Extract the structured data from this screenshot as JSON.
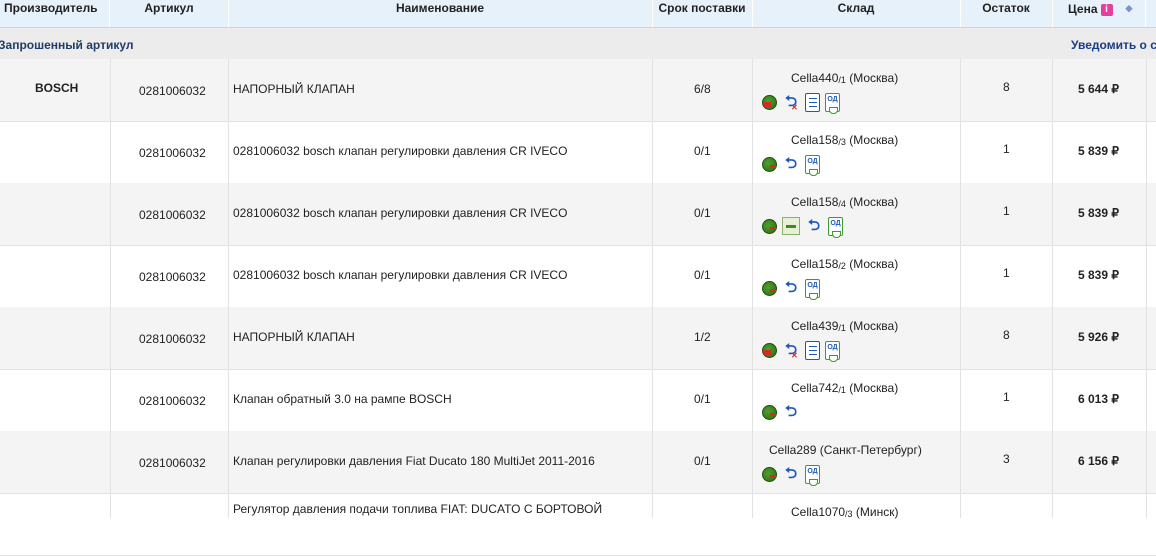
{
  "columns": {
    "manufacturer": "Производитель",
    "article": "Артикул",
    "name": "Наименование",
    "delivery": "Срок поставки",
    "warehouse": "Склад",
    "stock": "Остаток",
    "price": "Цена",
    "price_info_icon": "i"
  },
  "group": {
    "label": "Запрошенный артикул",
    "notify": "Уведомить о с"
  },
  "currency": "₽",
  "rows": [
    {
      "brand": "BOSCH",
      "article": "0281006032",
      "name": "НАПОРНЫЙ КЛАПАН",
      "delivery": "6/8",
      "warehouse": "Cella440",
      "wh_sub": "/1",
      "city": "(Москва)",
      "stock": "8",
      "price": "5 644",
      "icons": [
        "stock-partial-icon",
        "return-blocked-icon",
        "document-icon",
        "od-document-icon"
      ]
    },
    {
      "brand": "",
      "article": "0281006032",
      "name": "0281006032 bosch клапан регулировки давления CR IVECO",
      "delivery": "0/1",
      "warehouse": "Cella158",
      "wh_sub": "/3",
      "city": "(Москва)",
      "stock": "1",
      "price": "5 839",
      "icons": [
        "stock-icon",
        "return-icon",
        "od-document-icon"
      ]
    },
    {
      "brand": "",
      "article": "0281006032",
      "name": "0281006032 bosch клапан регулировки давления CR IVECO",
      "delivery": "0/1",
      "warehouse": "Cella158",
      "wh_sub": "/4",
      "city": "(Москва)",
      "stock": "1",
      "price": "5 839",
      "icons": [
        "stock-icon",
        "truck-icon",
        "return-icon",
        "od-document-icon"
      ]
    },
    {
      "brand": "",
      "article": "0281006032",
      "name": "0281006032 bosch клапан регулировки давления CR IVECO",
      "delivery": "0/1",
      "warehouse": "Cella158",
      "wh_sub": "/2",
      "city": "(Москва)",
      "stock": "1",
      "price": "5 839",
      "icons": [
        "stock-icon",
        "return-icon",
        "od-document-icon"
      ]
    },
    {
      "brand": "",
      "article": "0281006032",
      "name": "НАПОРНЫЙ КЛАПАН",
      "delivery": "1/2",
      "warehouse": "Cella439",
      "wh_sub": "/1",
      "city": "(Москва)",
      "stock": "8",
      "price": "5 926",
      "icons": [
        "stock-partial-icon",
        "return-blocked-icon",
        "document-icon",
        "od-document-icon"
      ]
    },
    {
      "brand": "",
      "article": "0281006032",
      "name": "Клапан обратный 3.0 на рампе BOSCH",
      "delivery": "0/1",
      "warehouse": "Cella742",
      "wh_sub": "/1",
      "city": "(Москва)",
      "stock": "1",
      "price": "6 013",
      "icons": [
        "stock-icon",
        "return-icon"
      ]
    },
    {
      "brand": "",
      "article": "0281006032",
      "name": "Клапан регулировки давления Fiat Ducato 180 MultiJet 2011-2016",
      "delivery": "0/1",
      "warehouse": "Cella289",
      "wh_sub": "",
      "city": "(Санкт-Петербург)",
      "stock": "3",
      "price": "6 156",
      "icons": [
        "stock-icon",
        "return-icon",
        "od-document-icon"
      ]
    },
    {
      "brand": "",
      "article": "",
      "name": "Регулятор давления подачи топлива FIAT: DUCATO С БОРТОВОЙ",
      "delivery": "",
      "warehouse": "Cella1070",
      "wh_sub": "/3",
      "city": "(Минск)",
      "stock": "",
      "price": "",
      "icons": []
    }
  ]
}
